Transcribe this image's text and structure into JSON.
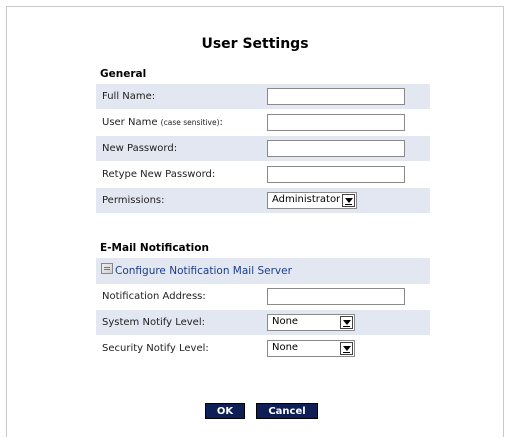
{
  "title": "User Settings",
  "general": {
    "heading": "General",
    "full_name": {
      "label": "Full Name:",
      "value": ""
    },
    "user_name": {
      "label": "User Name",
      "hint": "(case sensitive)",
      "colon": ":",
      "value": ""
    },
    "new_password": {
      "label": "New Password:",
      "value": ""
    },
    "retype_password": {
      "label": "Retype New Password:",
      "value": ""
    },
    "permissions": {
      "label": "Permissions:",
      "value": "Administrator"
    }
  },
  "email": {
    "heading": "E-Mail Notification",
    "configure_link": "Configure Notification Mail Server",
    "notification_address": {
      "label": "Notification Address:",
      "value": ""
    },
    "system_notify": {
      "label": "System Notify Level:",
      "value": "None"
    },
    "security_notify": {
      "label": "Security Notify Level:",
      "value": "None"
    }
  },
  "buttons": {
    "ok": "OK",
    "cancel": "Cancel"
  },
  "colors": {
    "row_shade": "#e3e7f1",
    "button_bg": "#0d1f55",
    "link": "#1c3d8a"
  }
}
